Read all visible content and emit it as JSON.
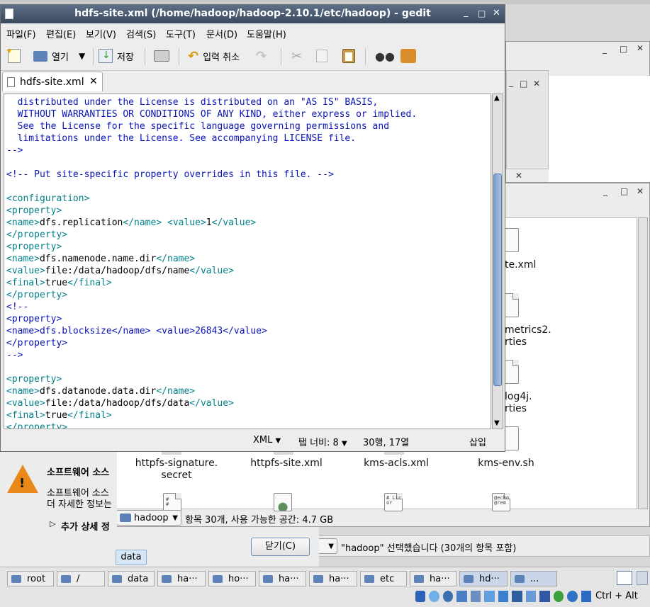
{
  "gedit": {
    "title": "hdfs-site.xml (/home/hadoop/hadoop-2.10.1/etc/hadoop) - gedit",
    "menu": [
      "파일(F)",
      "편집(E)",
      "보기(V)",
      "검색(S)",
      "도구(T)",
      "문서(D)",
      "도움말(H)"
    ],
    "toolbar": {
      "open": "열기",
      "save": "저장",
      "undo": "입력 취소"
    },
    "tab": "hdfs-site.xml",
    "lines": [
      "  distributed under the License is distributed on an \"AS IS\" BASIS,",
      "  WITHOUT WARRANTIES OR CONDITIONS OF ANY KIND, either express or implied.",
      "  See the License for the specific language governing permissions and",
      "  limitations under the License. See accompanying LICENSE file.",
      "-->",
      "",
      "<!-- Put site-specific property overrides in this file. -->",
      "",
      "<configuration>",
      "<property>",
      "<name>dfs.replication</name> <value>1</value>",
      "</property>",
      "<property>",
      "<name>dfs.namenode.name.dir</name>",
      "<value>file:/data/hadoop/dfs/name</value>",
      "<final>true</final>",
      "</property>",
      "<!--",
      "<property>",
      "<name>dfs.blocksize</name> <value>26843</value>",
      "</property>",
      "-->",
      "",
      "<property>",
      "<name>dfs.datanode.data.dir</name>",
      "<value>file:/data/hadoop/dfs/data</value>",
      "<final>true</final>",
      "</property>"
    ],
    "status": {
      "lang": "XML",
      "tabwidth": "탭 너비:  8",
      "position": "30행, 17열",
      "mode": "삽입"
    }
  },
  "filemanager": {
    "files_row1": [
      "httpfs-signature.\nsecret",
      "httpfs-site.xml",
      "kms-acls.xml",
      "kms-env.sh"
    ],
    "side_labels": [
      "te.xml",
      "metrics2.\nrties",
      "log4j.\nrties"
    ],
    "location": "hadoop",
    "status": "항목 30개, 사용 가능한 공간: 4.7 GB",
    "selection_status": "\"hadoop\" 선택했습니다 (30개의 항목 포함)"
  },
  "dialog": {
    "title": "소프트웨어 소스",
    "text1": "소프트웨어 소스",
    "text2": "더 자세한 정보는",
    "expander": "추가 상세 정",
    "tooltip": "data",
    "close_button": "닫기(C)"
  },
  "taskbar": {
    "items": [
      "root",
      "/",
      "data",
      "ha···",
      "ho···",
      "ha···",
      "ha···",
      "etc",
      "ha···",
      "hd···",
      "..."
    ],
    "keyhint": "Ctrl + Alt"
  },
  "colors": {
    "comment": "#0a14b6",
    "tag": "#04828a",
    "titlebar": "#46566d"
  }
}
